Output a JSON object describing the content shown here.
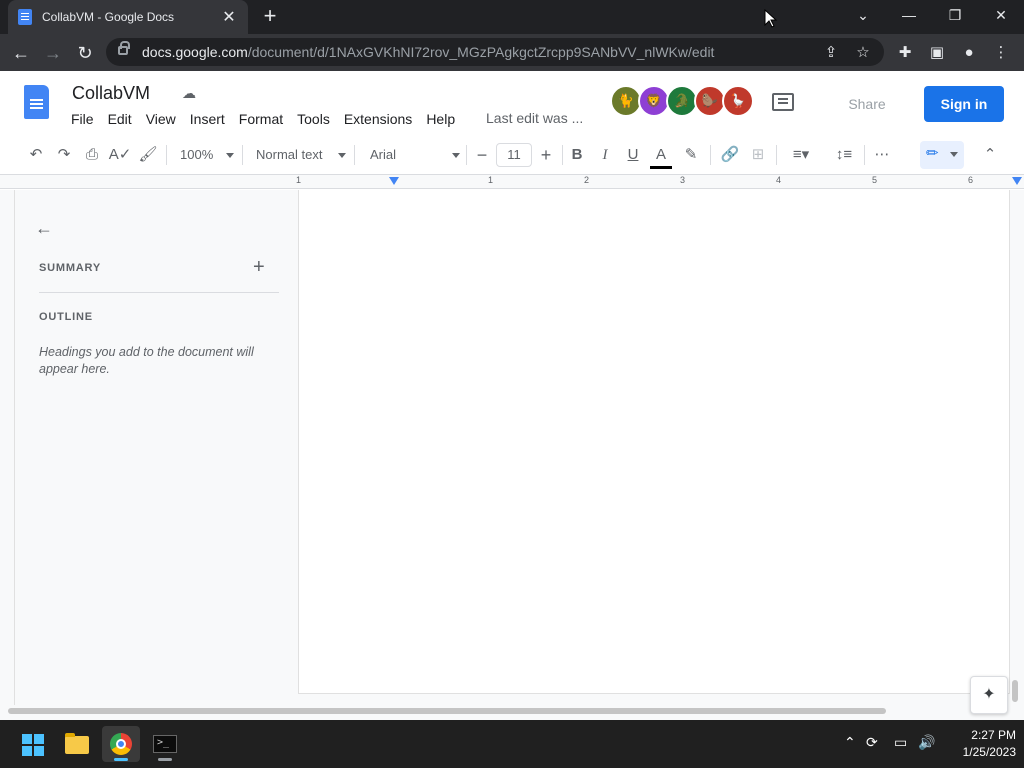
{
  "browser": {
    "tab_title": "CollabVM - Google Docs",
    "tab_close": "✕",
    "new_tab": "+",
    "url_host": "docs.google.com",
    "url_path": "/document/d/1NAxGVKhNI72rov_MGzPAgkgctZrcpp9SANbVV_nlWKw/edit"
  },
  "doc": {
    "title": "CollabVM",
    "menu": [
      "File",
      "Edit",
      "View",
      "Insert",
      "Format",
      "Tools",
      "Extensions",
      "Help"
    ],
    "last_edit": "Last edit was ...",
    "share_label": "Share",
    "signin_label": "Sign in",
    "avatar_colors": [
      "#6b7a2a",
      "#8e3fd4",
      "#1e7a3c",
      "#c0392b",
      "#c0392b"
    ]
  },
  "toolbar": {
    "zoom": "100%",
    "style": "Normal text",
    "font": "Arial",
    "font_size": "11"
  },
  "ruler": {
    "labels": [
      "1",
      "1",
      "2",
      "3",
      "4",
      "5",
      "6"
    ]
  },
  "outline": {
    "summary_label": "SUMMARY",
    "outline_label": "OUTLINE",
    "hint": "Headings you add to the document will appear here."
  },
  "taskbar": {
    "time": "2:27 PM",
    "date": "1/25/2023"
  },
  "colors": {
    "accent": "#1a73e8",
    "chrome_dark": "#202124"
  }
}
